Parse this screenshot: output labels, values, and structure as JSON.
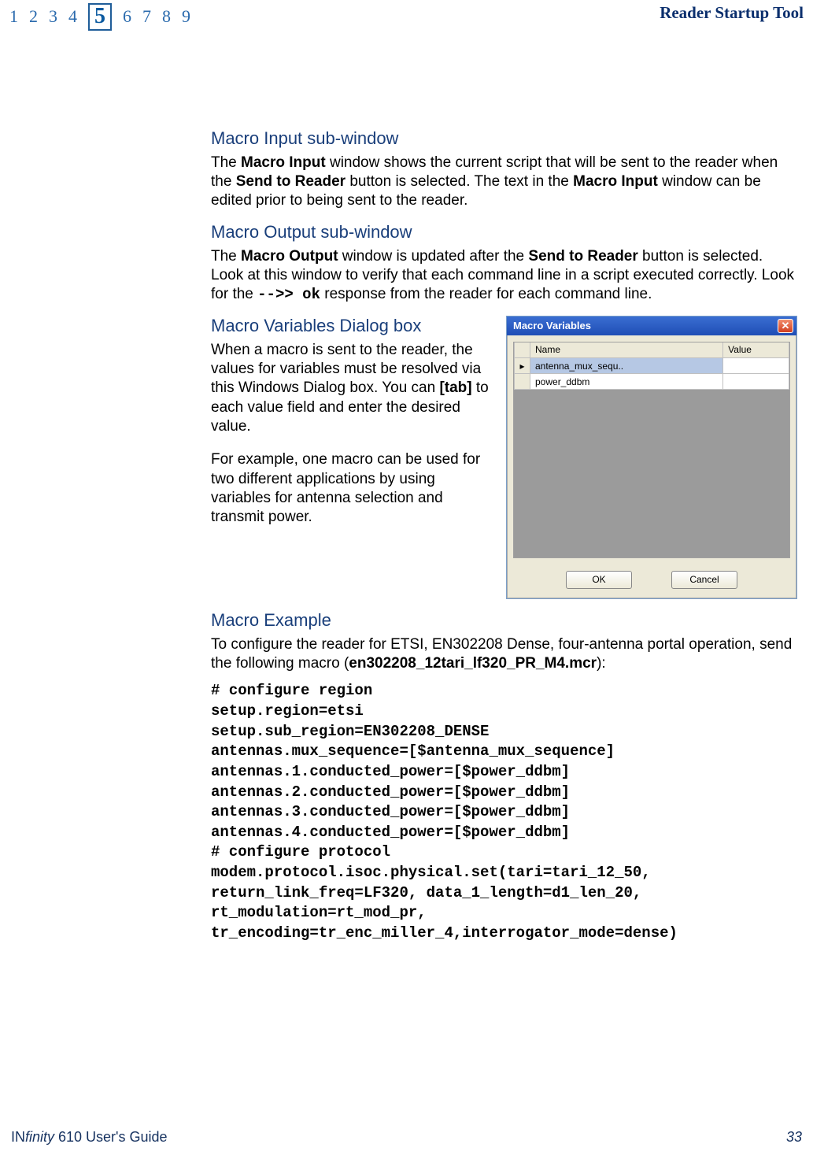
{
  "header": {
    "chapters": [
      "1",
      "2",
      "3",
      "4",
      "5",
      "6",
      "7",
      "8",
      "9"
    ],
    "current_chapter": "5",
    "section_title": "Reader Startup Tool"
  },
  "s1": {
    "heading": "Macro Input sub-window",
    "p1_a": "The ",
    "p1_b": "Macro Input",
    "p1_c": " window shows the current script that will be sent to the reader when the ",
    "p1_d": "Send to Reader",
    "p1_e": " button is selected. The text in the ",
    "p1_f": "Macro Input",
    "p1_g": " window can be edited prior to being sent to the reader."
  },
  "s2": {
    "heading": "Macro Output sub-window",
    "p1_a": "The ",
    "p1_b": "Macro Output",
    "p1_c": " window is updated after the ",
    "p1_d": "Send to Reader",
    "p1_e": " button is selected. Look at this window to verify that each command line in a script executed correctly. Look for the ",
    "p1_f": "-->> ok",
    "p1_g": " response from the reader for each command line."
  },
  "s3": {
    "heading": "Macro Variables Dialog box",
    "p1_a": "When a macro is sent to the reader, the values for variables must be resolved via this Windows Dialog box. You can ",
    "p1_b": "[tab]",
    "p1_c": " to each value field and enter the desired value.",
    "p2": "For example, one macro can be used for two different applications by using variables for antenna selection and transmit power."
  },
  "dialog": {
    "title": "Macro Variables",
    "col_name": "Name",
    "col_value": "Value",
    "rows": [
      {
        "name": "antenna_mux_sequ..",
        "value": ""
      },
      {
        "name": "power_ddbm",
        "value": ""
      }
    ],
    "ok_label": "OK",
    "cancel_label": "Cancel",
    "row_marker": "▸"
  },
  "s4": {
    "heading": "Macro Example",
    "p1_a": "To configure the reader for ETSI, EN302208 Dense, four-antenna portal operation, send the following macro (",
    "p1_b": "en302208_12tari_lf320_PR_M4.mcr",
    "p1_c": "):",
    "code": "# configure region\nsetup.region=etsi\nsetup.sub_region=EN302208_DENSE\nantennas.mux_sequence=[$antenna_mux_sequence]\nantennas.1.conducted_power=[$power_ddbm]\nantennas.2.conducted_power=[$power_ddbm]\nantennas.3.conducted_power=[$power_ddbm]\nantennas.4.conducted_power=[$power_ddbm]\n# configure protocol\nmodem.protocol.isoc.physical.set(tari=tari_12_50, return_link_freq=LF320, data_1_length=d1_len_20, rt_modulation=rt_mod_pr, tr_encoding=tr_enc_miller_4,interrogator_mode=dense)"
  },
  "footer": {
    "guide_prefix": "IN",
    "guide_italic": "finity",
    "guide_rest": " 610 User's Guide",
    "page": "33"
  }
}
